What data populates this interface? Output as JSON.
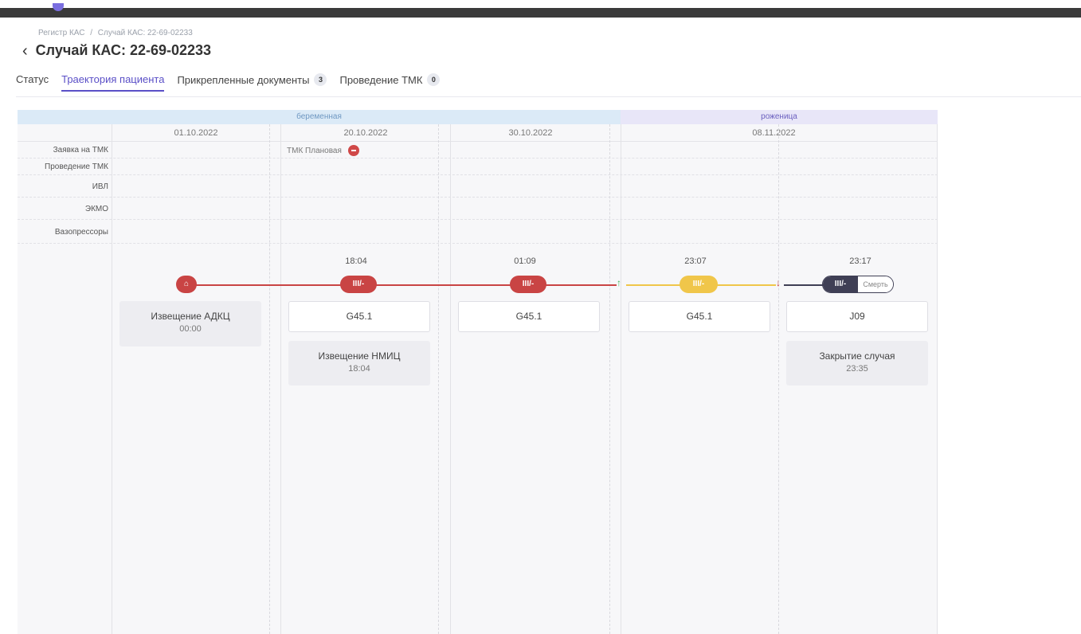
{
  "breadcrumb": {
    "root": "Регистр КАС",
    "separator": "/",
    "current": "Случай КАС: 22-69-02233"
  },
  "page": {
    "back_icon": "‹",
    "title": "Случай КАС: 22-69-02233"
  },
  "tabs": [
    {
      "label": "Статус",
      "count": null
    },
    {
      "label": "Траектория пациента",
      "count": null,
      "active": true
    },
    {
      "label": "Прикрепленные документы",
      "count": "3"
    },
    {
      "label": "Проведение ТМК",
      "count": "0"
    }
  ],
  "phases": {
    "pregnant": "беременная",
    "labor": "роженица"
  },
  "dates": [
    "01.10.2022",
    "20.10.2022",
    "30.10.2022",
    "08.11.2022"
  ],
  "row_labels": {
    "tmk_request": "Заявка на ТМК",
    "tmk_conduct": "Проведение ТМК",
    "ivl": "ИВЛ",
    "ecmo": "ЭКМО",
    "vaso": "Вазопрессоры"
  },
  "tmk_request_item": "ТМК Плановая",
  "timeline": {
    "times": [
      "18:04",
      "01:09",
      "23:07",
      "23:17"
    ],
    "pill_label": "III/-",
    "death_label": "Смерть",
    "arrow_up": "↑",
    "arrow_down": "↓",
    "home_icon": "⌂"
  },
  "codes": [
    "G45.1",
    "G45.1",
    "G45.1",
    "J09"
  ],
  "notes": {
    "adkc": {
      "title": "Извещение АДКЦ",
      "time": "00:00"
    },
    "nmic": {
      "title": "Извещение НМИЦ",
      "time": "18:04"
    },
    "close": {
      "title": "Закрытие случая",
      "time": "23:35"
    }
  },
  "colors": {
    "accent": "#5a4fc7",
    "red": "#c94444",
    "yellow": "#f0c64a",
    "dark": "#3f3f55",
    "green": "#3fb55a"
  }
}
